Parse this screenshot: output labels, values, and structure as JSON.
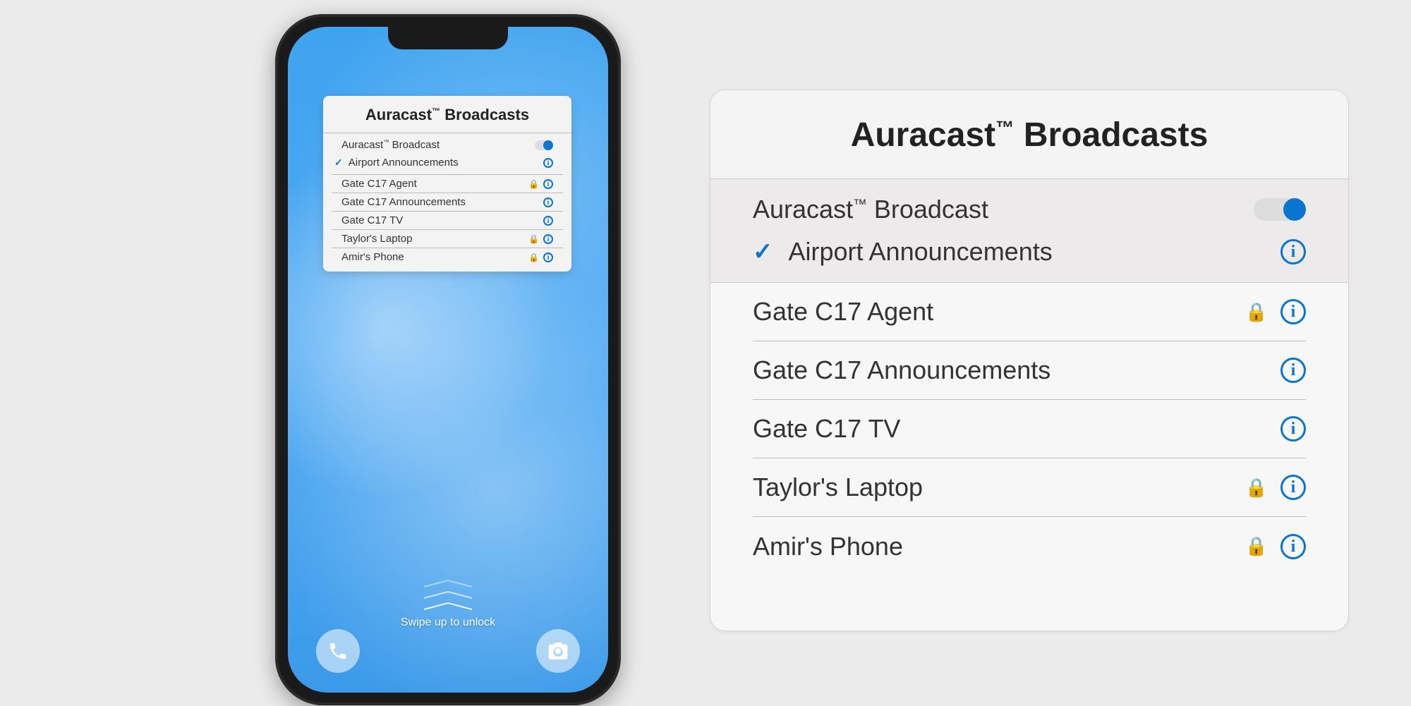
{
  "card": {
    "title_html": "Auracast™ Broadcasts",
    "toggle_label_html": "Auracast™ Broadcast",
    "toggle_on": true,
    "selected": "Airport Announcements",
    "items": [
      {
        "label": "Gate C17 Agent",
        "locked": true
      },
      {
        "label": "Gate C17 Announcements",
        "locked": false
      },
      {
        "label": "Gate C17 TV",
        "locked": false
      },
      {
        "label": "Taylor's Laptop",
        "locked": true
      },
      {
        "label": "Amir's Phone",
        "locked": true
      }
    ]
  },
  "lockscreen": {
    "swipe_hint": "Swipe up to unlock"
  },
  "colors": {
    "accent": "#0a74d1"
  }
}
